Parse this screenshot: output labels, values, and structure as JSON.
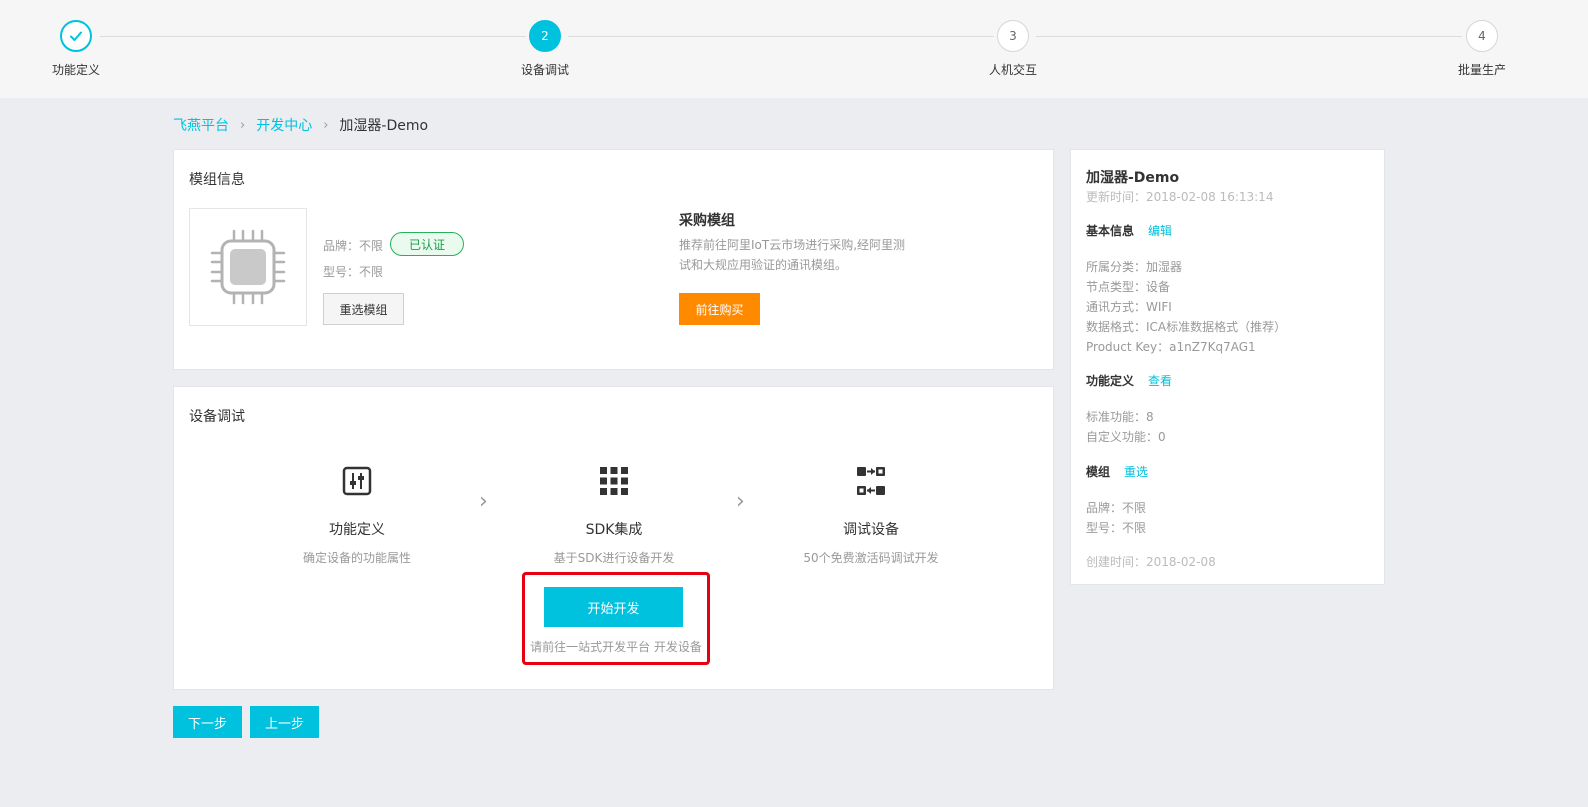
{
  "stepper": {
    "steps": [
      {
        "label": "功能定义",
        "num": "",
        "state": "done"
      },
      {
        "label": "设备调试",
        "num": "2",
        "state": "active"
      },
      {
        "label": "人机交互",
        "num": "3",
        "state": "todo"
      },
      {
        "label": "批量生产",
        "num": "4",
        "state": "todo"
      }
    ]
  },
  "breadcrumb": {
    "items": [
      "飞燕平台",
      "开发中心"
    ],
    "current": "加湿器-Demo",
    "separator": "›"
  },
  "module": {
    "title": "模组信息",
    "brand": "品牌：不限",
    "model": "型号：不限",
    "badge": "已认证",
    "reselect_label": "重选模组",
    "buy_title": "采购模组",
    "buy_desc": "推荐前往阿里IoT云市场进行采购,经阿里测试和大规应用验证的通讯模组。",
    "buy_button": "前往购买"
  },
  "debug": {
    "title": "设备调试",
    "flow": [
      {
        "name": "功能定义",
        "desc": "确定设备的功能属性",
        "icon": "sliders-icon"
      },
      {
        "name": "SDK集成",
        "desc": "基于SDK进行设备开发",
        "icon": "grid-icon"
      },
      {
        "name": "调试设备",
        "desc": "50个免费激活码调试开发",
        "icon": "devices-icon"
      }
    ],
    "arrow": "›",
    "start_button": "开始开发",
    "start_hint": "请前往一站式开发平台 开发设备"
  },
  "footer": {
    "next_label": "下一步",
    "prev_label": "上一步"
  },
  "side": {
    "title": "加湿器-Demo",
    "updated": "更新时间：2018-02-08 16:13:14",
    "basic_label": "基本信息",
    "basic_link": "编辑",
    "category": "所属分类：加湿器",
    "node_type": "节点类型：设备",
    "comm": "通讯方式：WIFI",
    "data_format": "数据格式：ICA标准数据格式（推荐）",
    "product_key": "Product Key：a1nZ7Kq7AG1",
    "func_label": "功能定义",
    "func_link": "查看",
    "std_func": "标准功能：8",
    "custom_func": "自定义功能：0",
    "module_label": "模组",
    "module_link": "重选",
    "brand": "品牌：不限",
    "model": "型号：不限",
    "created": "创建时间：2018-02-08"
  },
  "colors": {
    "accent": "#00c1de",
    "orange": "#ff8a00",
    "highlight": "#e60012",
    "success": "#1a9e4a"
  }
}
